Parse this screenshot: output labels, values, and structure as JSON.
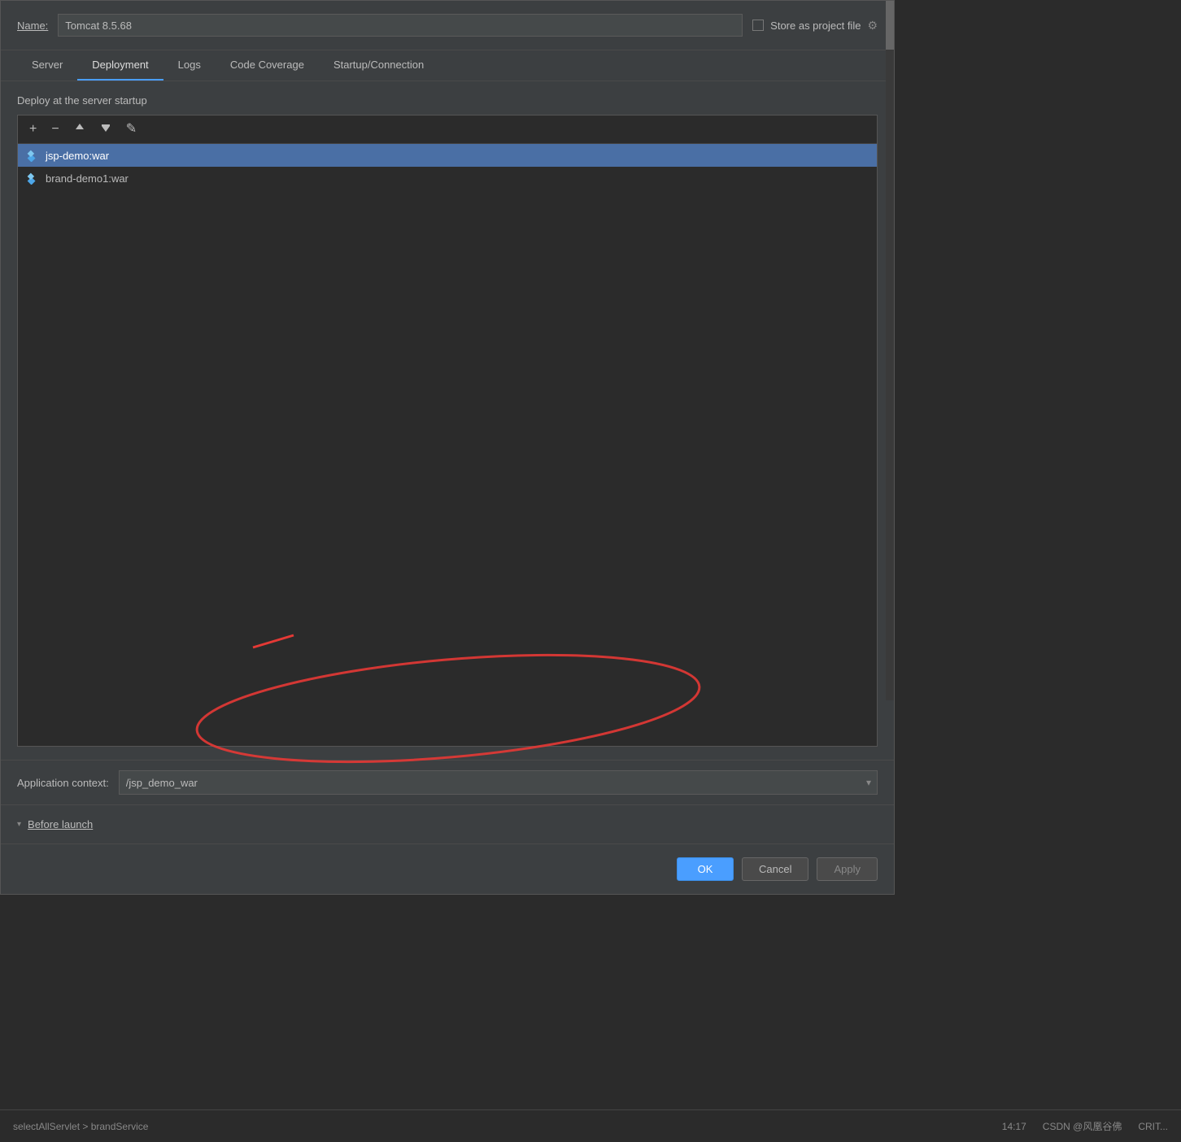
{
  "header": {
    "name_label": "Name:",
    "name_value": "Tomcat 8.5.68",
    "store_label": "Store as project file"
  },
  "tabs": {
    "items": [
      {
        "label": "Server",
        "active": false
      },
      {
        "label": "Deployment",
        "active": true
      },
      {
        "label": "Logs",
        "active": false
      },
      {
        "label": "Code Coverage",
        "active": false
      },
      {
        "label": "Startup/Connection",
        "active": false
      }
    ]
  },
  "deployment": {
    "section_title": "Deploy at the server startup",
    "toolbar": {
      "add": "+",
      "remove": "−",
      "move_up": "↑",
      "move_down": "↓",
      "edit": "✎"
    },
    "items": [
      {
        "label": "jsp-demo:war",
        "selected": true
      },
      {
        "label": "brand-demo1:war",
        "selected": false
      }
    ]
  },
  "app_context": {
    "label": "Application context:",
    "value": "/jsp_demo_war"
  },
  "before_launch": {
    "label": "Before launch"
  },
  "buttons": {
    "ok": "OK",
    "cancel": "Cancel",
    "apply": "Apply"
  },
  "status_bar": {
    "left_text": "selectAllServlet > brandService",
    "time": "14:17",
    "right_items": [
      "CSDN @风凰谷佛",
      "CRIT..."
    ]
  }
}
